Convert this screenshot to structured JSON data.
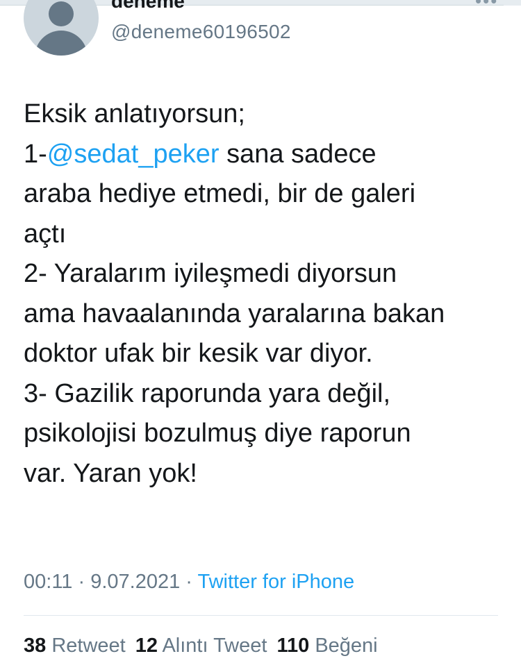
{
  "author": {
    "display_name": "deneme",
    "handle": "@deneme60196502"
  },
  "tweet": {
    "lines": [
      {
        "text": "Eksik anlatıyorsun;"
      },
      {
        "prefix": "1-",
        "mention": "@sedat_peker",
        "suffix": " sana sadece"
      },
      {
        "text": "araba hediye etmedi, bir de galeri"
      },
      {
        "text": "açtı"
      },
      {
        "text": "2- Yaralarım iyileşmedi diyorsun"
      },
      {
        "text": "ama havaalanında yaralarına bakan"
      },
      {
        "text": "doktor ufak bir kesik var diyor."
      },
      {
        "text": "3- Gazilik raporunda yara değil,"
      },
      {
        "text": "psikolojisi bozulmuş diye raporun"
      },
      {
        "text": "var. Yaran yok!"
      }
    ]
  },
  "meta": {
    "time": "00:11",
    "date": "9.07.2021",
    "separator": " · ",
    "source": "Twitter for iPhone"
  },
  "stats": {
    "retweets_count": "38",
    "retweets_label": "Retweet",
    "quotes_count": "12",
    "quotes_label": "Alıntı Tweet",
    "likes_count": "110",
    "likes_label": "Beğeni"
  },
  "icons": {
    "more": "more-icon",
    "avatar": "default-avatar"
  },
  "colors": {
    "link": "#1da1f2",
    "secondary_text": "#657786",
    "primary_text": "#14171a"
  }
}
